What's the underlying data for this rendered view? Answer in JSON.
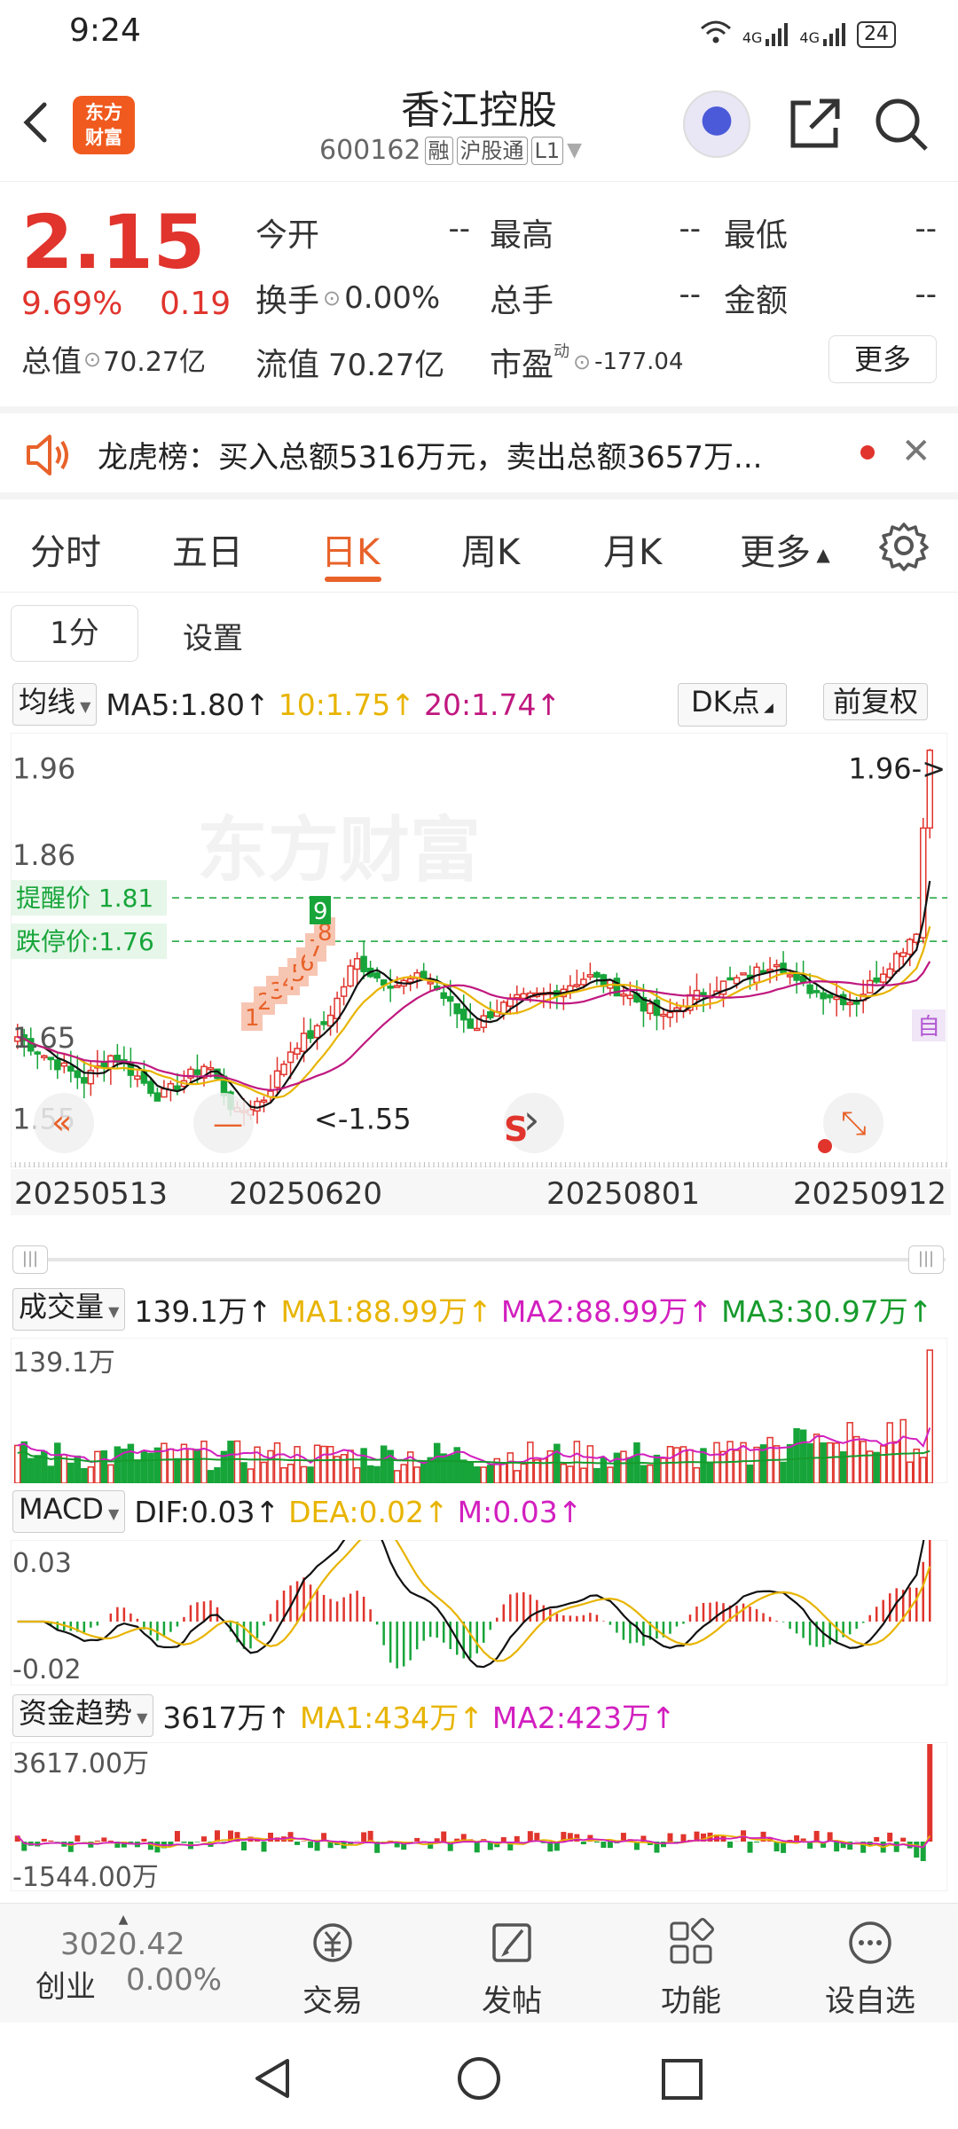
{
  "status": {
    "time": "9:24",
    "net1": "4G",
    "net2": "4G",
    "battery": "24"
  },
  "header": {
    "logo_line1": "东方",
    "logo_line2": "财富",
    "stock_name": "香江控股",
    "code": "600162",
    "tag1": "融",
    "tag2": "沪股通",
    "tag3": "L1"
  },
  "quote": {
    "price": "2.15",
    "pct": "9.69%",
    "chg": "0.19",
    "total_label": "总值",
    "total_val": "70.27亿",
    "open_label": "今开",
    "open_val": "--",
    "high_label": "最高",
    "high_val": "--",
    "low_label": "最低",
    "low_val": "--",
    "turnover_label": "换手",
    "turnover_val": "0.00%",
    "volume_label": "总手",
    "volume_val": "--",
    "amount_label": "金额",
    "amount_val": "--",
    "float_label": "流值",
    "float_val": "70.27亿",
    "pe_label": "市盈",
    "pe_sup": "动",
    "pe_val": "-177.04",
    "more_label": "更多"
  },
  "notice": {
    "text": "龙虎榜：买入总额5316万元，卖出总额3657万..."
  },
  "tabs": {
    "items": [
      "分时",
      "五日",
      "日K",
      "周K",
      "月K",
      "更多"
    ],
    "active": "日K"
  },
  "subtabs": {
    "min1": "1分",
    "settings": "设置"
  },
  "ma_bar": {
    "dropdown": "均线",
    "ma5": "MA5:1.80↑",
    "ma10": "10:1.75↑",
    "ma20": "20:1.74↑",
    "dk": "DK点",
    "fq": "前复权"
  },
  "kline": {
    "y_labels": [
      "1.96",
      "1.86",
      "1.65",
      "1.55"
    ],
    "hi_marker": "1.96->",
    "lo_marker": "<-1.55",
    "alert_label": "提醒价 1.81",
    "stop_label": "跌停价:1.76",
    "watermark": "东方财富",
    "auto_badge": "自",
    "seq_nums": [
      "1",
      "2",
      "3",
      "4",
      "5",
      "6",
      "7",
      "8",
      "9"
    ],
    "dates": [
      "20250513",
      "20250620",
      "20250801",
      "20250912"
    ],
    "colors": {
      "up": "#e0342d",
      "down": "#17a53a",
      "ma5": "#111111",
      "ma10": "#e8b400",
      "ma20": "#c0187f"
    }
  },
  "chart_data": {
    "type": "candlestick",
    "y_range": [
      1.55,
      1.96
    ],
    "dates": [
      "20250513",
      "20250620",
      "20250801",
      "20250912"
    ],
    "alert_price": 1.81,
    "limit_down": 1.76,
    "high": 1.96,
    "low": 1.55
  },
  "volume": {
    "dropdown": "成交量",
    "val": "139.1万↑",
    "ma1": "MA1:88.99万↑",
    "ma2": "MA2:88.99万↑",
    "ma3": "MA3:30.97万↑",
    "top": "139.1万"
  },
  "macd": {
    "dropdown": "MACD",
    "dif": "DIF:0.03↑",
    "dea": "DEA:0.02↑",
    "m": "M:0.03↑",
    "top": "0.03",
    "bottom": "-0.02"
  },
  "fund": {
    "dropdown": "资金趋势",
    "val": "3617万↑",
    "ma1": "MA1:434万↑",
    "ma2": "MA2:423万↑",
    "top": "3617.00万",
    "bottom": "-1544.00万"
  },
  "bottom_nav": {
    "index_val": "3020.42",
    "index_name": "创业",
    "index_pct": "0.00%",
    "trade": "交易",
    "post": "发帖",
    "func": "功能",
    "fav": "设自选"
  }
}
